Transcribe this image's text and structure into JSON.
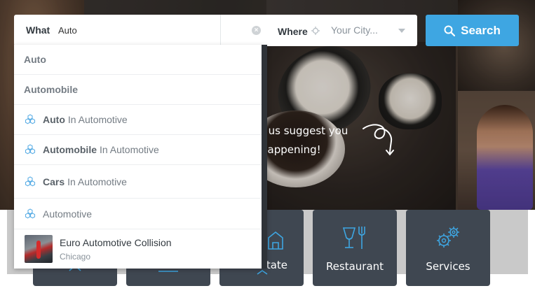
{
  "search": {
    "what_label": "What",
    "what_value": "Auto",
    "where_label": "Where",
    "where_placeholder": "Your City...",
    "button_label": "Search"
  },
  "hero": {
    "line1": "t us suggest you",
    "line2": "happening!"
  },
  "dropdown": {
    "items": [
      {
        "type": "keyword",
        "label": "Auto"
      },
      {
        "type": "keyword",
        "label": "Automobile"
      },
      {
        "type": "in_category",
        "term": "Auto",
        "suffix": "In Automotive"
      },
      {
        "type": "in_category",
        "term": "Automobile",
        "suffix": "In Automotive"
      },
      {
        "type": "in_category",
        "term": "Cars",
        "suffix": "In Automotive"
      },
      {
        "type": "category",
        "label": "Automotive"
      },
      {
        "type": "listing",
        "title": "Euro Automotive Collision",
        "location": "Chicago"
      }
    ]
  },
  "categories": [
    {
      "label": "state",
      "icon": "home-icon"
    },
    {
      "label": "Restaurant",
      "icon": "cutlery-icon"
    },
    {
      "label": "Services",
      "icon": "gears-icon"
    }
  ],
  "colors": {
    "accent": "#3ea6e2",
    "tile": "#3f4751",
    "dropdown_icon": "#5fb0e6"
  }
}
